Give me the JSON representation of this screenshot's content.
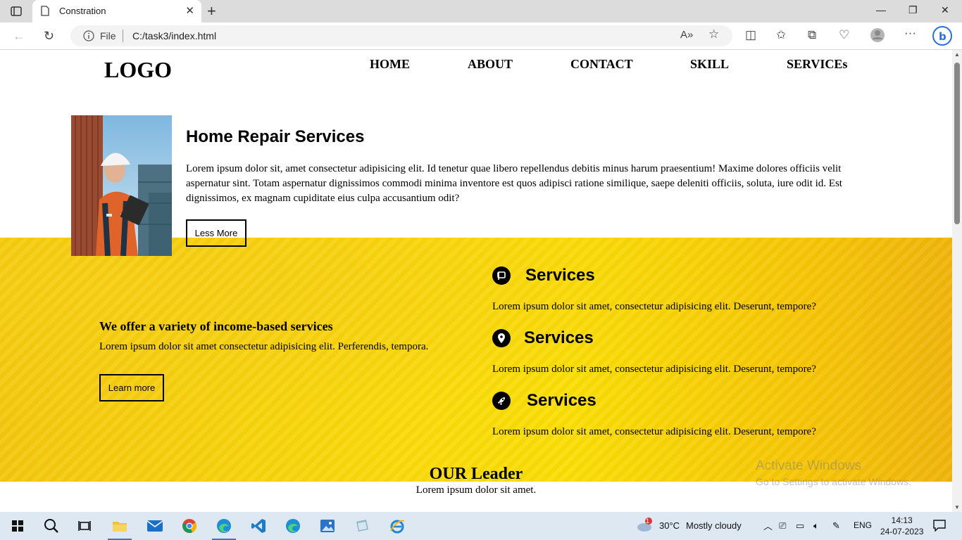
{
  "browser": {
    "tab_title": "Constration",
    "address_prefix": "File",
    "address_url": "C:/task3/index.html"
  },
  "site": {
    "logo": "LOGO",
    "nav": [
      "HOME",
      "ABOUT",
      "CONTACT",
      "SKILL",
      "SERVICEs"
    ],
    "hero": {
      "title": "Home Repair Services",
      "text": "Lorem ipsum dolor sit, amet consectetur adipisicing elit. Id tenetur quae libero repellendus debitis minus harum praesentium! Maxime dolores officiis velit aspernatur sint. Totam aspernatur dignissimos commodi minima inventore est quos adipisci ratione similique, saepe deleniti officiis, soluta, iure odit id. Est dignissimos, ex magnam cupiditate eius culpa accusantium odit?",
      "button": "Less More"
    },
    "offer": {
      "title": "We offer a variety of income-based services",
      "text": "Lorem ipsum dolor sit amet consectetur adipisicing elit. Perferendis, tempora.",
      "button": "Learn more"
    },
    "services": [
      {
        "icon": "flag-icon",
        "title": "Services",
        "text": "Lorem ipsum dolor sit amet, consectetur adipisicing elit. Deserunt, tempore?"
      },
      {
        "icon": "location-pin-icon",
        "title": "Services",
        "text": "Lorem ipsum dolor sit amet, consectetur adipisicing elit. Deserunt, tempore?"
      },
      {
        "icon": "rocket-icon",
        "title": "Services",
        "text": "Lorem ipsum dolor sit amet, consectetur adipisicing elit. Deserunt, tempore?"
      }
    ],
    "leader": {
      "title": "OUR Leader",
      "subtitle": "Lorem ipsum dolor sit amet."
    },
    "accent_color": "#fad80a"
  },
  "os": {
    "watermark_title": "Activate Windows",
    "watermark_sub": "Go to Settings to activate Windows.",
    "weather": "30°C",
    "weather_desc": "Mostly cloudy",
    "weather_badge": "1",
    "language": "ENG",
    "time": "14:13",
    "date": "24-07-2023"
  }
}
